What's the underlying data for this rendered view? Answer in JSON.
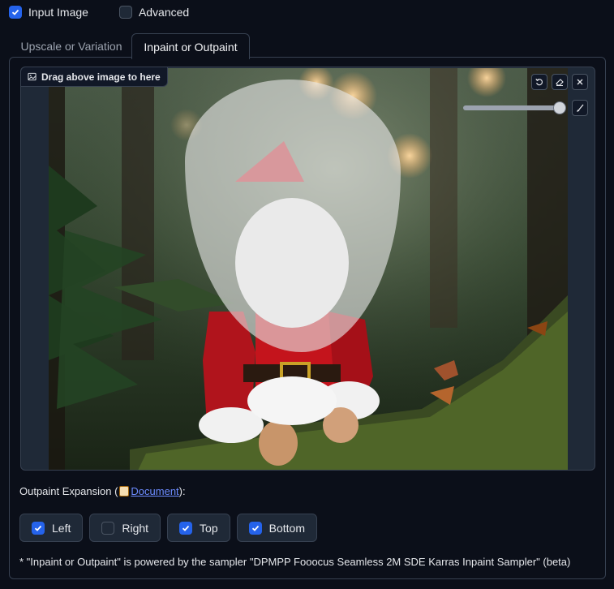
{
  "top_options": [
    {
      "label": "Input Image",
      "checked": true
    },
    {
      "label": "Advanced",
      "checked": false
    }
  ],
  "tabs": [
    {
      "label": "Upscale or Variation",
      "active": false
    },
    {
      "label": "Inpaint or Outpaint",
      "active": true
    }
  ],
  "image_panel": {
    "label": "Drag above image to here",
    "icons": [
      "image-icon",
      "undo-icon",
      "eraser-icon",
      "close-icon",
      "brush-icon"
    ],
    "brush_size_fraction": 0.96
  },
  "outpaint": {
    "label_prefix": "Outpaint Expansion (",
    "doc_link": "Document",
    "label_suffix": "):",
    "directions": [
      {
        "label": "Left",
        "checked": true
      },
      {
        "label": "Right",
        "checked": false
      },
      {
        "label": "Top",
        "checked": true
      },
      {
        "label": "Bottom",
        "checked": true
      }
    ]
  },
  "footer_note": "* \"Inpaint or Outpaint\" is powered by the sampler \"DPMPP Fooocus Seamless 2M SDE Karras Inpaint Sampler\" (beta)",
  "colors": {
    "accent": "#2563eb",
    "background": "#0b0f19",
    "panel": "#1f2937"
  }
}
